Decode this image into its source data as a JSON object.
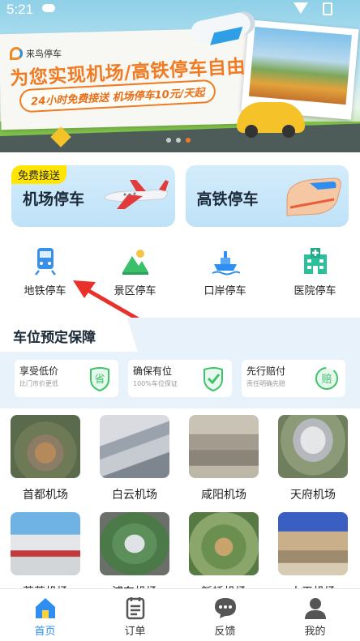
{
  "status_bar": {
    "time": "5:21"
  },
  "banner": {
    "brand": "来鸟停车",
    "headline": "为您实现机场/高铁停车自由",
    "subline": "24小时免费接送 机场停车10元/天起"
  },
  "parking_cards": [
    {
      "label": "机场停车",
      "badge": "免费接送"
    },
    {
      "label": "高铁停车"
    }
  ],
  "categories": [
    {
      "label": "地铁停车",
      "icon": "subway-icon"
    },
    {
      "label": "景区停车",
      "icon": "scenic-mountain-icon"
    },
    {
      "label": "口岸停车",
      "icon": "ship-icon"
    },
    {
      "label": "医院停车",
      "icon": "hospital-icon"
    }
  ],
  "guarantee": {
    "title": "车位预定保障",
    "items": [
      {
        "title": "享受低价",
        "desc": "比门市价更低",
        "icon": "save-money-icon",
        "glyph": "省"
      },
      {
        "title": "确保有位",
        "desc": "100%车位保证",
        "icon": "shield-check-icon"
      },
      {
        "title": "先行赔付",
        "desc": "责任明确先赔",
        "icon": "compensation-icon",
        "glyph": "赔"
      }
    ]
  },
  "airports": [
    {
      "name": "首都机场"
    },
    {
      "name": "白云机场"
    },
    {
      "name": "咸阳机场"
    },
    {
      "name": "天府机场"
    },
    {
      "name": "萧萧机场"
    },
    {
      "name": "浦东机场"
    },
    {
      "name": "新桥机场"
    },
    {
      "name": "太平机场"
    }
  ],
  "tabbar": [
    {
      "label": "首页",
      "icon": "home-icon",
      "active": true
    },
    {
      "label": "订单",
      "icon": "order-list-icon",
      "active": false
    },
    {
      "label": "反馈",
      "icon": "feedback-chat-icon",
      "active": false
    },
    {
      "label": "我的",
      "icon": "profile-icon",
      "active": false
    }
  ],
  "colors": {
    "accent": "#2f8ef0",
    "orange": "#f07b22",
    "badge_yellow": "#ffe500",
    "card_blue": "#c9e7fa"
  }
}
